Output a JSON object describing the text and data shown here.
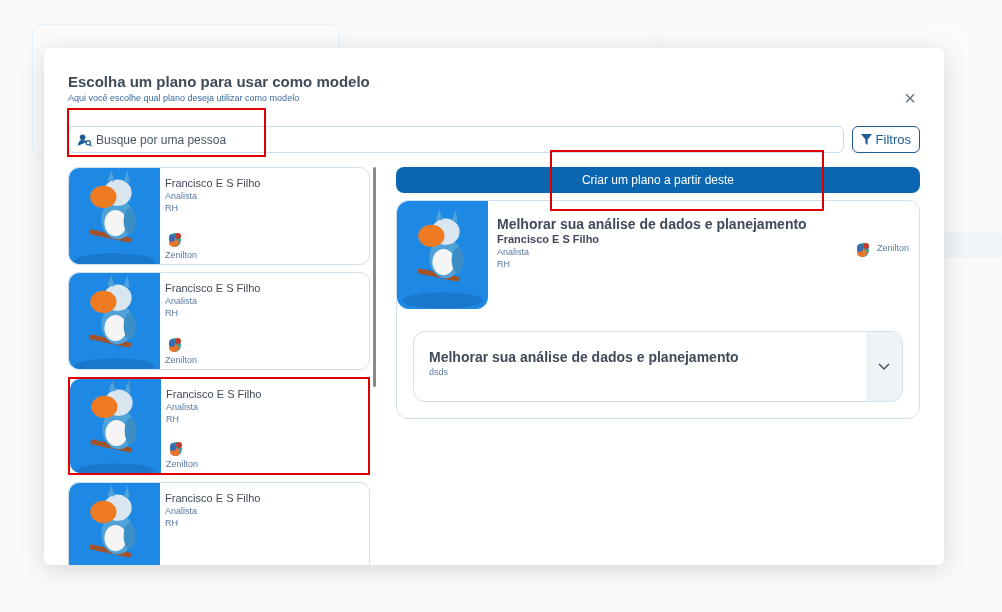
{
  "modal": {
    "title": "Escolha um plano para usar como modelo",
    "subtitle": "Aqui você escolhe qual plano deseja utilizar como modelo",
    "close": "×",
    "search": {
      "placeholder": "Busque por uma pessoa",
      "highlighted": true
    },
    "filter_button": "Filtros",
    "plans": [
      {
        "name": "Francisco E S Filho",
        "role": "Analista",
        "department": "RH",
        "owner": "Zenilton",
        "highlighted": false
      },
      {
        "name": "Francisco E S Filho",
        "role": "Analista",
        "department": "RH",
        "owner": "Zenilton",
        "highlighted": false
      },
      {
        "name": "Francisco E S Filho",
        "role": "Analista",
        "department": "RH",
        "owner": "Zenilton",
        "highlighted": true
      },
      {
        "name": "Francisco E S Filho",
        "role": "Analista",
        "department": "RH",
        "highlighted": false
      }
    ],
    "create_button": {
      "label": "Criar um plano a partir deste",
      "highlighted": true
    },
    "detail": {
      "title": "Melhorar sua análise de dados e planejamento",
      "name": "Francisco E S Filho",
      "role": "Analista",
      "department": "RH",
      "owner": "Zenilton",
      "goal": {
        "title": "Melhorar sua análise de dados e planejamento",
        "description": "dsds",
        "expanded": false
      }
    }
  }
}
